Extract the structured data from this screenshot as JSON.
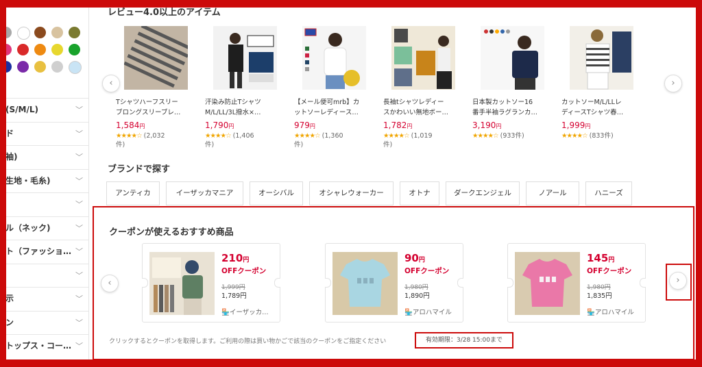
{
  "sidebar": {
    "color_swatches": [
      {
        "name": "gray",
        "color": "#a8a8a8"
      },
      {
        "name": "white",
        "color": "#ffffff"
      },
      {
        "name": "brown",
        "color": "#8b4a1e"
      },
      {
        "name": "beige",
        "color": "#d8c3a0"
      },
      {
        "name": "khaki",
        "color": "#7a7a30"
      },
      {
        "name": "pink",
        "color": "#e0357a"
      },
      {
        "name": "red",
        "color": "#d92a2a"
      },
      {
        "name": "orange",
        "color": "#ee8a12"
      },
      {
        "name": "yellow",
        "color": "#e7d72e"
      },
      {
        "name": "green",
        "color": "#19a32c"
      },
      {
        "name": "navy",
        "color": "#1b2fa0"
      },
      {
        "name": "purple",
        "color": "#7a2aa8"
      },
      {
        "name": "gold",
        "color": "#e8c040"
      },
      {
        "name": "silver",
        "color": "#cfcfcf"
      },
      {
        "name": "light-blue",
        "color": "#c9e4f5"
      }
    ],
    "filters": [
      "(S/M/L)",
      "ド",
      "袖)",
      "生地・毛糸)",
      "",
      "ル（ネック)",
      "ト（ファッショ…",
      "",
      "示",
      "ン",
      "トップス・コー…"
    ]
  },
  "review_section": {
    "title": "レビュー4.0以上のアイテム",
    "prev_arrow": "‹",
    "next_arrow": "›",
    "products": [
      {
        "name_line1": "Tシャツハーフスリー",
        "name_line2": "ブロングスリーブレ…",
        "price": "1,584",
        "yen": "円",
        "stars": "★★★★☆",
        "reviews_line1": "(2,032",
        "reviews_line2": "件)"
      },
      {
        "name_line1": "汗染み防止Tシャツ",
        "name_line2": "M/L/LL/3L撥水×…",
        "price": "1,790",
        "yen": "円",
        "stars": "★★★★☆",
        "reviews_line1": "(1,406",
        "reviews_line2": "件)"
      },
      {
        "name_line1": "【メール便可mrb】カ",
        "name_line2": "ットソーレディース…",
        "price": "979",
        "yen": "円",
        "stars": "★★★★☆",
        "reviews_line1": "(1,360",
        "reviews_line2": "件)"
      },
      {
        "name_line1": "長袖tシャツレディー",
        "name_line2": "スかわいい無地ボー…",
        "price": "1,782",
        "yen": "円",
        "stars": "★★★★☆",
        "reviews_line1": "(1,019",
        "reviews_line2": "件)"
      },
      {
        "name_line1": "日本製カットソー16",
        "name_line2": "番手半袖ラグランカ…",
        "price": "3,190",
        "yen": "円",
        "stars": "★★★★☆",
        "reviews_line1": "(933件)",
        "reviews_line2": ""
      },
      {
        "name_line1": "カットソーM/L/LLレ",
        "name_line2": "ディースTシャツ春…",
        "price": "1,999",
        "yen": "円",
        "stars": "★★★★☆",
        "reviews_line1": "(833件)",
        "reviews_line2": ""
      }
    ]
  },
  "brand_section": {
    "title": "ブランドで探す",
    "brands": [
      "アンティカ",
      "イーザッカマニア",
      "オーシバル",
      "オシャレウォーカー",
      "オトナ",
      "ダークエンジェル",
      "ノアール",
      "ハニーズ"
    ]
  },
  "coupon_section": {
    "title": "クーポンが使えるおすすめ商品",
    "prev_arrow": "‹",
    "next_arrow": "›",
    "coupons": [
      {
        "amount": "210",
        "unit": "円",
        "off": "OFFクーポン",
        "original": "1,999円",
        "discounted": "1,789円",
        "shop": "イーザッカ…"
      },
      {
        "amount": "90",
        "unit": "円",
        "off": "OFFクーポン",
        "original": "1,980円",
        "discounted": "1,890円",
        "shop": "アロハマイル"
      },
      {
        "amount": "145",
        "unit": "円",
        "off": "OFFクーポン",
        "original": "1,980円",
        "discounted": "1,835円",
        "shop": "アロハマイル"
      }
    ],
    "note": "クリックするとクーポンを取得します。ご利用の際は買い物かごで該当のクーポンをご指定ください",
    "expiry": "有効期限：3/28 15:00まで"
  },
  "colors": {
    "accent_red": "#cc0a0a",
    "price_red": "#d4002f",
    "star": "#f0a500"
  }
}
